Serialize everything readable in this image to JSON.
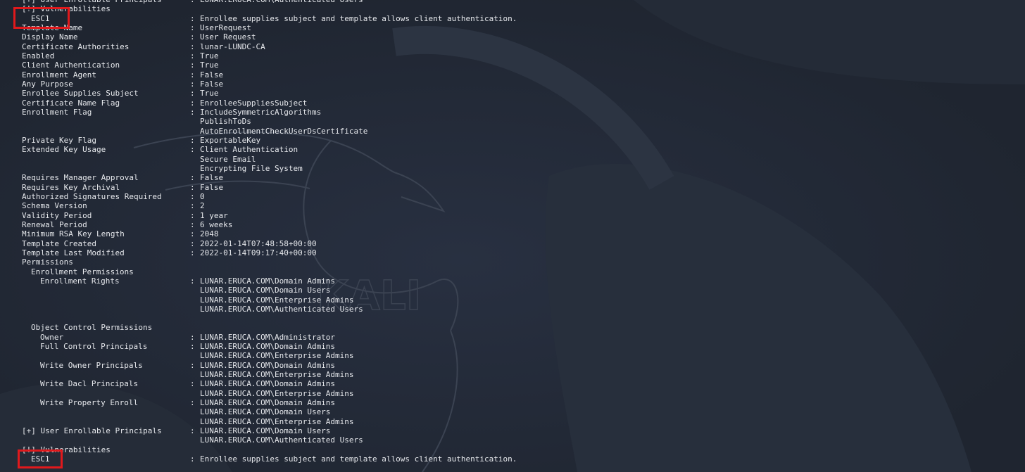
{
  "theme": {
    "background": "#1f2530",
    "text": "#e6e8ec",
    "highlight": "#e0191c"
  },
  "watermark": {
    "text": "KALI",
    "icon": "kali-dragon-icon"
  },
  "lines": [
    {
      "indent": 31,
      "key": "[+] User Enrollable Principals",
      "value": "LUNAR.ERUCA.COM\\Authenticated Users"
    },
    {
      "indent": 31,
      "key": "[!] Vulnerabilities",
      "value": ""
    },
    {
      "indent": 44,
      "key": "ESC1",
      "value": "Enrollee supplies subject and template allows client authentication."
    },
    {
      "indent": 31,
      "key": "Template Name",
      "value": "UserRequest"
    },
    {
      "indent": 31,
      "key": "Display Name",
      "value": "User Request"
    },
    {
      "indent": 31,
      "key": "Certificate Authorities",
      "value": "lunar-LUNDC-CA"
    },
    {
      "indent": 31,
      "key": "Enabled",
      "value": "True"
    },
    {
      "indent": 31,
      "key": "Client Authentication",
      "value": "True"
    },
    {
      "indent": 31,
      "key": "Enrollment Agent",
      "value": "False"
    },
    {
      "indent": 31,
      "key": "Any Purpose",
      "value": "False"
    },
    {
      "indent": 31,
      "key": "Enrollee Supplies Subject",
      "value": "True"
    },
    {
      "indent": 31,
      "key": "Certificate Name Flag",
      "value": "EnrolleeSuppliesSubject"
    },
    {
      "indent": 31,
      "key": "Enrollment Flag",
      "value": "IncludeSymmetricAlgorithms"
    },
    {
      "indent": 31,
      "key": "",
      "value": "PublishToDs"
    },
    {
      "indent": 31,
      "key": "",
      "value": "AutoEnrollmentCheckUserDsCertificate"
    },
    {
      "indent": 31,
      "key": "Private Key Flag",
      "value": "ExportableKey"
    },
    {
      "indent": 31,
      "key": "Extended Key Usage",
      "value": "Client Authentication"
    },
    {
      "indent": 31,
      "key": "",
      "value": "Secure Email"
    },
    {
      "indent": 31,
      "key": "",
      "value": "Encrypting File System"
    },
    {
      "indent": 31,
      "key": "Requires Manager Approval",
      "value": "False"
    },
    {
      "indent": 31,
      "key": "Requires Key Archival",
      "value": "False"
    },
    {
      "indent": 31,
      "key": "Authorized Signatures Required",
      "value": "0"
    },
    {
      "indent": 31,
      "key": "Schema Version",
      "value": "2"
    },
    {
      "indent": 31,
      "key": "Validity Period",
      "value": "1 year"
    },
    {
      "indent": 31,
      "key": "Renewal Period",
      "value": "6 weeks"
    },
    {
      "indent": 31,
      "key": "Minimum RSA Key Length",
      "value": "2048"
    },
    {
      "indent": 31,
      "key": "Template Created",
      "value": "2022-01-14T07:48:58+00:00"
    },
    {
      "indent": 31,
      "key": "Template Last Modified",
      "value": "2022-01-14T09:17:40+00:00"
    },
    {
      "indent": 31,
      "key": "Permissions",
      "value": ""
    },
    {
      "indent": 44,
      "key": "Enrollment Permissions",
      "value": ""
    },
    {
      "indent": 57,
      "key": "Enrollment Rights",
      "value": "LUNAR.ERUCA.COM\\Domain Admins"
    },
    {
      "indent": 57,
      "key": "",
      "value": "LUNAR.ERUCA.COM\\Domain Users"
    },
    {
      "indent": 57,
      "key": "",
      "value": "LUNAR.ERUCA.COM\\Enterprise Admins"
    },
    {
      "indent": 57,
      "key": "",
      "value": "LUNAR.ERUCA.COM\\Authenticated Users"
    },
    {
      "indent": 31,
      "key": "",
      "value": ""
    },
    {
      "indent": 44,
      "key": "Object Control Permissions",
      "value": ""
    },
    {
      "indent": 57,
      "key": "Owner",
      "value": "LUNAR.ERUCA.COM\\Administrator"
    },
    {
      "indent": 57,
      "key": "Full Control Principals",
      "value": "LUNAR.ERUCA.COM\\Domain Admins"
    },
    {
      "indent": 57,
      "key": "",
      "value": "LUNAR.ERUCA.COM\\Enterprise Admins"
    },
    {
      "indent": 57,
      "key": "Write Owner Principals",
      "value": "LUNAR.ERUCA.COM\\Domain Admins"
    },
    {
      "indent": 57,
      "key": "",
      "value": "LUNAR.ERUCA.COM\\Enterprise Admins"
    },
    {
      "indent": 57,
      "key": "Write Dacl Principals",
      "value": "LUNAR.ERUCA.COM\\Domain Admins"
    },
    {
      "indent": 57,
      "key": "",
      "value": "LUNAR.ERUCA.COM\\Enterprise Admins"
    },
    {
      "indent": 57,
      "key": "Write Property Enroll",
      "value": "LUNAR.ERUCA.COM\\Domain Admins"
    },
    {
      "indent": 57,
      "key": "",
      "value": "LUNAR.ERUCA.COM\\Domain Users"
    },
    {
      "indent": 57,
      "key": "",
      "value": "LUNAR.ERUCA.COM\\Enterprise Admins"
    },
    {
      "indent": 31,
      "key": "[+] User Enrollable Principals",
      "value": "LUNAR.ERUCA.COM\\Domain Users"
    },
    {
      "indent": 31,
      "key": "",
      "value": "LUNAR.ERUCA.COM\\Authenticated Users"
    },
    {
      "indent": 31,
      "key": "[!] Vulnerabilities",
      "value": ""
    },
    {
      "indent": 44,
      "key": "ESC1",
      "value": "Enrollee supplies subject and template allows client authentication."
    }
  ]
}
